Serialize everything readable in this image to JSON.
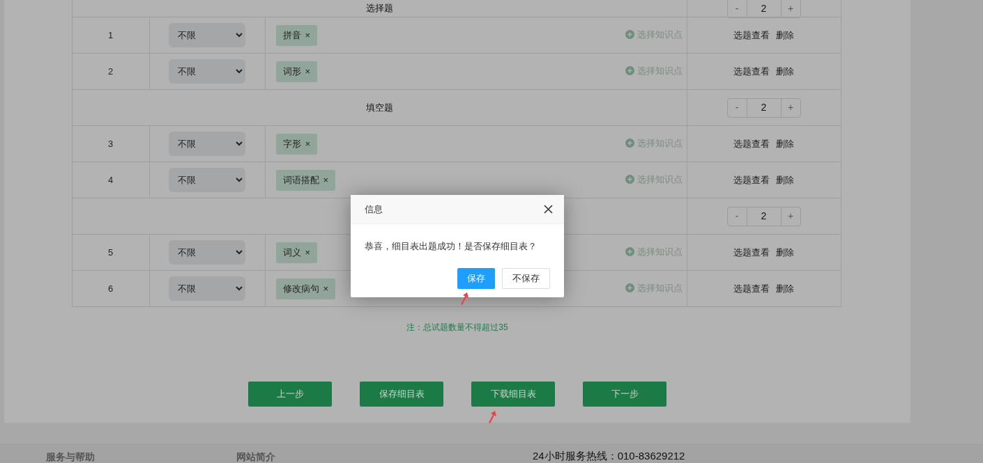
{
  "table": {
    "rows": [
      {
        "kind": "section",
        "title": "选择题",
        "count": "2",
        "minus": "-",
        "plus": "+"
      },
      {
        "kind": "question",
        "number": "1",
        "difficulty": "不限",
        "tags": [
          {
            "label": "拼音",
            "remove": "×"
          }
        ],
        "add_label": "选择知识点",
        "actions": [
          "选题查看",
          "删除"
        ]
      },
      {
        "kind": "question",
        "number": "2",
        "difficulty": "不限",
        "tags": [
          {
            "label": "词形",
            "remove": "×"
          }
        ],
        "add_label": "选择知识点",
        "actions": [
          "选题查看",
          "删除"
        ]
      },
      {
        "kind": "section",
        "title": "填空题",
        "count": "2",
        "minus": "-",
        "plus": "+"
      },
      {
        "kind": "question",
        "number": "3",
        "difficulty": "不限",
        "tags": [
          {
            "label": "字形",
            "remove": "×"
          }
        ],
        "add_label": "选择知识点",
        "actions": [
          "选题查看",
          "删除"
        ]
      },
      {
        "kind": "question",
        "number": "4",
        "difficulty": "不限",
        "tags": [
          {
            "label": "词语搭配",
            "remove": "×"
          }
        ],
        "add_label": "选择知识点",
        "actions": [
          "选题查看",
          "删除"
        ]
      },
      {
        "kind": "section",
        "count": "2",
        "minus": "-",
        "plus": "+"
      },
      {
        "kind": "question",
        "number": "5",
        "difficulty": "不限",
        "tags": [
          {
            "label": "词义",
            "remove": "×"
          }
        ],
        "add_label": "选择知识点",
        "actions": [
          "选题查看",
          "删除"
        ]
      },
      {
        "kind": "question",
        "number": "6",
        "difficulty": "不限",
        "tags": [
          {
            "label": "修改病句",
            "remove": "×"
          }
        ],
        "add_label": "选择知识点",
        "actions": [
          "选题查看",
          "删除"
        ]
      }
    ]
  },
  "note": "注：总试题数量不得超过35",
  "buttons": [
    "上一步",
    "保存细目表",
    "下载细目表",
    "下一步"
  ],
  "footer": {
    "columns": [
      "服务与帮助",
      "网站简介"
    ],
    "hotline": "24小时服务热线：010-83629212"
  },
  "dialog": {
    "title": "信息",
    "message": "恭喜，细目表出题成功！是否保存细目表？",
    "buttons": [
      {
        "label": "保存",
        "primary": true
      },
      {
        "label": "不保存",
        "primary": false
      }
    ]
  }
}
